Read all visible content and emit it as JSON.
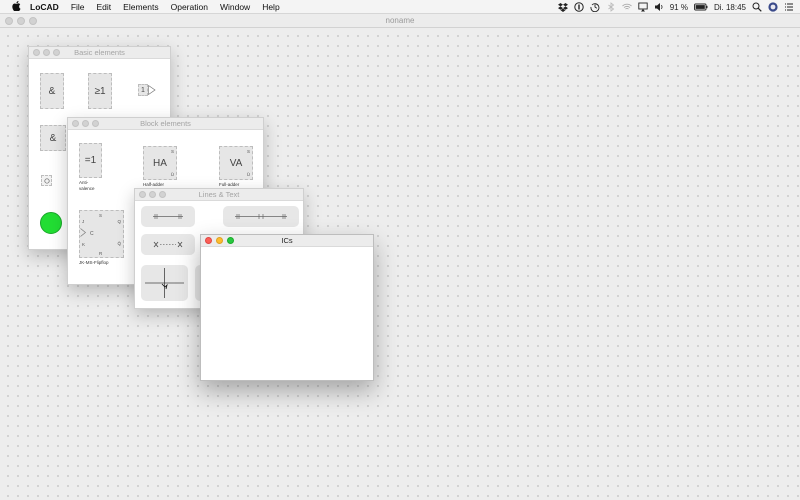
{
  "menubar": {
    "app_name": "LoCAD",
    "items": [
      "File",
      "Edit",
      "Elements",
      "Operation",
      "Window",
      "Help"
    ],
    "battery": "91 %",
    "clock": "Di. 18:45"
  },
  "document": {
    "title": "noname"
  },
  "basic_elements": {
    "title": "Basic elements",
    "and_label": "&",
    "or_label": "≥1",
    "buffer_label": "1",
    "and2_label": "&"
  },
  "block_elements": {
    "title": "Block elements",
    "xor_label": "=1",
    "xor_caption": "Anti-\nvalence",
    "ha_label": "HA",
    "ha_caption": "Half-adder",
    "va_label": "VA",
    "va_caption": "Full-adder",
    "ff_caption": "JK-MS-Flipflop",
    "pin_s": "S",
    "pin_u": "Ü",
    "pin_j": "J",
    "pin_k": "K",
    "pin_c": "C",
    "pin_q": "Q",
    "pin_qbar": "Q̄",
    "pin_r": "R"
  },
  "lines_text": {
    "title": "Lines & Text"
  },
  "ics": {
    "title": "ICs"
  },
  "colors": {
    "led_green": "#22dd33",
    "accent": "#fc5f57"
  },
  "icons": [
    "apple-icon",
    "dropbox-icon",
    "sync-icon",
    "time-machine-icon",
    "bluetooth-icon",
    "wifi-icon",
    "airplay-icon",
    "volume-icon",
    "battery-icon",
    "search-icon",
    "user-icon",
    "list-icon"
  ]
}
